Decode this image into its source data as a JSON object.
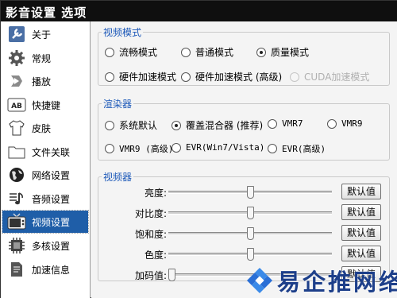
{
  "window": {
    "title": "影音设置  选项"
  },
  "sidebar": {
    "items": [
      {
        "label": "关于",
        "icon": "wrench-icon"
      },
      {
        "label": "常规",
        "icon": "gear-icon"
      },
      {
        "label": "播放",
        "icon": "play-arrow-icon"
      },
      {
        "label": "快捷键",
        "icon": "keyboard-key-icon"
      },
      {
        "label": "皮肤",
        "icon": "shirt-icon"
      },
      {
        "label": "文件关联",
        "icon": "folder-icon"
      },
      {
        "label": "网络设置",
        "icon": "globe-icon"
      },
      {
        "label": "音频设置",
        "icon": "music-note-icon"
      },
      {
        "label": "视频设置",
        "icon": "tv-icon"
      },
      {
        "label": "多核设置",
        "icon": "cpu-icon"
      },
      {
        "label": "加速信息",
        "icon": "info-document-icon"
      }
    ],
    "active_index": 8
  },
  "video_mode": {
    "title": "视频模式",
    "options": [
      {
        "label": "流畅模式",
        "checked": false,
        "disabled": false
      },
      {
        "label": "普通模式",
        "checked": false,
        "disabled": false
      },
      {
        "label": "质量模式",
        "checked": true,
        "disabled": false
      },
      {
        "label": "硬件加速模式",
        "checked": false,
        "disabled": false
      },
      {
        "label": "硬件加速模式 (高级)",
        "checked": false,
        "disabled": false
      },
      {
        "label": "CUDA加速模式",
        "checked": false,
        "disabled": true
      }
    ]
  },
  "renderer": {
    "title": "渲染器",
    "options": [
      {
        "label": "系统默认",
        "checked": false
      },
      {
        "label": "覆盖混合器 (推荐)",
        "checked": true
      },
      {
        "label": "VMR7",
        "checked": false
      },
      {
        "label": "VMR9",
        "checked": false
      },
      {
        "label": "VMR9 (高级)",
        "checked": false
      },
      {
        "label": "EVR(Win7/Vista)",
        "checked": false
      },
      {
        "label": "EVR(高级)",
        "checked": false
      }
    ]
  },
  "equalizer": {
    "title": "视频器",
    "reset_label": "默认值",
    "sliders": [
      {
        "label": "亮度:",
        "value": 0.5
      },
      {
        "label": "对比度:",
        "value": 0.5
      },
      {
        "label": "饱和度:",
        "value": 0.5
      },
      {
        "label": "色度:",
        "value": 0.5
      },
      {
        "label": "加码值:",
        "value": 0.0
      }
    ]
  },
  "watermark": {
    "text": "易企推网络",
    "logo": "watermark-logo-icon"
  },
  "colors": {
    "accent": "#1a57b8",
    "selection": "#1f5ea8",
    "titlebar": "#0f0f0f"
  }
}
